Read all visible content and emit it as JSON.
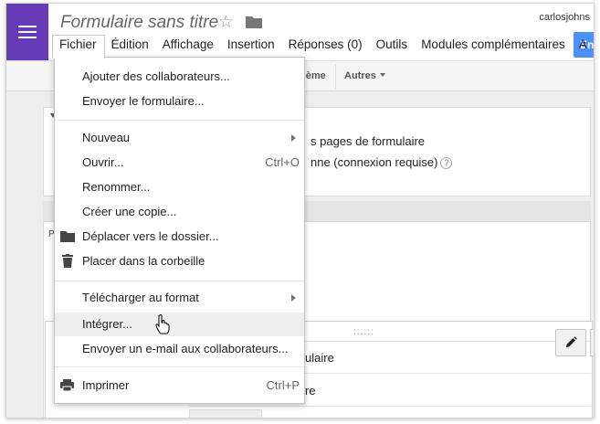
{
  "header": {
    "title": "Formulaire sans titre",
    "user": "carlosjohns",
    "share_label": "En"
  },
  "menubar": [
    {
      "label": "Fichier",
      "active": true
    },
    {
      "label": "Édition"
    },
    {
      "label": "Affichage"
    },
    {
      "label": "Insertion"
    },
    {
      "label": "Réponses (0)"
    },
    {
      "label": "Outils"
    },
    {
      "label": "Modules complémentaires"
    },
    {
      "label": "A"
    }
  ],
  "toolbar": {
    "theme_partial": "hème",
    "autres": "Autres"
  },
  "panel1": {
    "line1": "s pages de formulaire",
    "line2": "nne (connexion requise)",
    "help": "?"
  },
  "panel2": {
    "letter": "P"
  },
  "question": {
    "drag": "::::::",
    "field1": "ulaire",
    "field2": "re"
  },
  "file_menu": {
    "items": [
      {
        "label": "Ajouter des collaborateurs..."
      },
      {
        "label": "Envoyer le formulaire..."
      },
      {
        "label": "Nouveau",
        "submenu": true
      },
      {
        "label": "Ouvrir...",
        "shortcut": "Ctrl+O"
      },
      {
        "label": "Renommer..."
      },
      {
        "label": "Créer une copie..."
      },
      {
        "label": "Déplacer vers le dossier...",
        "icon": "folder-icon"
      },
      {
        "label": "Placer dans la corbeille",
        "icon": "trash-icon"
      },
      {
        "label": "Télécharger au format",
        "submenu": true
      },
      {
        "label": "Intégrer...",
        "hover": true
      },
      {
        "label": "Envoyer un e-mail aux collaborateurs..."
      },
      {
        "label": "Imprimer",
        "shortcut": "Ctrl+P",
        "icon": "printer-icon"
      }
    ]
  },
  "colors": {
    "app_accent": "#673ab7",
    "share_button": "#4d90fe"
  }
}
